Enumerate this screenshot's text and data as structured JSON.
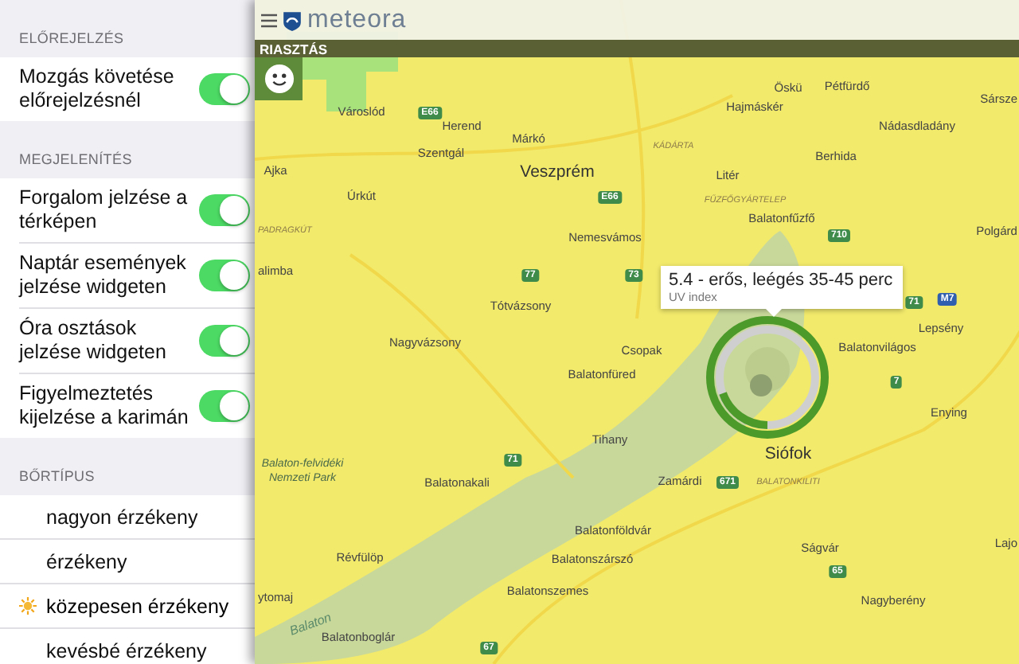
{
  "sidebar": {
    "sections": [
      {
        "title": "ELŐREJELZÉS",
        "kind": "toggles",
        "items": [
          {
            "label": "Mozgás követése előrejelzésnél",
            "on": true
          }
        ]
      },
      {
        "title": "MEGJELENÍTÉS",
        "kind": "toggles",
        "items": [
          {
            "label": "Forgalom jelzése a térképen",
            "on": true
          },
          {
            "label": "Naptár események jelzése widgeten",
            "on": true
          },
          {
            "label": "Óra osztások jelzése widgeten",
            "on": true
          },
          {
            "label": "Figyelmeztetés kijelzése a karimán",
            "on": true
          }
        ]
      },
      {
        "title": "BŐRTÍPUS",
        "kind": "choices",
        "items": [
          {
            "label": "nagyon érzékeny",
            "selected": false
          },
          {
            "label": "érzékeny",
            "selected": false
          },
          {
            "label": "közepesen érzékeny",
            "selected": true
          },
          {
            "label": "kevésbé érzékeny",
            "selected": false
          }
        ]
      }
    ]
  },
  "app_bar": {
    "brand": "meteora"
  },
  "alert_bar": {
    "title": "RIASZTÁS"
  },
  "map": {
    "labels": [
      {
        "text": "Városlód",
        "kind": "place"
      },
      {
        "text": "E66",
        "kind": "road"
      },
      {
        "text": "Herend",
        "kind": "place"
      },
      {
        "text": "Márkó",
        "kind": "place"
      },
      {
        "text": "Szentgál",
        "kind": "place"
      },
      {
        "text": "Ajka",
        "kind": "place"
      },
      {
        "text": "Veszprém",
        "kind": "city"
      },
      {
        "text": "KÁDÁRTA",
        "kind": "area"
      },
      {
        "text": "Öskü",
        "kind": "place"
      },
      {
        "text": "Pétfürdő",
        "kind": "place"
      },
      {
        "text": "Hajmáskér",
        "kind": "place"
      },
      {
        "text": "Nádasdladány",
        "kind": "place"
      },
      {
        "text": "Sársze",
        "kind": "place"
      },
      {
        "text": "Berhida",
        "kind": "place"
      },
      {
        "text": "Litér",
        "kind": "place"
      },
      {
        "text": "Úrkút",
        "kind": "place"
      },
      {
        "text": "E66",
        "kind": "road"
      },
      {
        "text": "FŰZFŐGYÁRTELEP",
        "kind": "area"
      },
      {
        "text": "Balatonfűzfő",
        "kind": "place"
      },
      {
        "text": "PADRAGKÚT",
        "kind": "area"
      },
      {
        "text": "Nemesvámos",
        "kind": "place"
      },
      {
        "text": "710",
        "kind": "road"
      },
      {
        "text": "Polgárd",
        "kind": "place"
      },
      {
        "text": "alimba",
        "kind": "place"
      },
      {
        "text": "77",
        "kind": "road"
      },
      {
        "text": "73",
        "kind": "road"
      },
      {
        "text": "71",
        "kind": "road"
      },
      {
        "text": "Tótvázsony",
        "kind": "place"
      },
      {
        "text": "M7",
        "kind": "highway"
      },
      {
        "text": "Lepsény",
        "kind": "place"
      },
      {
        "text": "Nagyvázsony",
        "kind": "place"
      },
      {
        "text": "Csopak",
        "kind": "place"
      },
      {
        "text": "Balatonfüred",
        "kind": "place"
      },
      {
        "text": "Balatonvilágos",
        "kind": "place"
      },
      {
        "text": "7",
        "kind": "road"
      },
      {
        "text": "Enying",
        "kind": "place"
      },
      {
        "text": "Tihany",
        "kind": "place"
      },
      {
        "text": "Siófok",
        "kind": "city"
      },
      {
        "text": "Balaton-felvidéki Nemzeti Park",
        "kind": "park"
      },
      {
        "text": "71",
        "kind": "road"
      },
      {
        "text": "Balatonakali",
        "kind": "place"
      },
      {
        "text": "Zamárdi",
        "kind": "place"
      },
      {
        "text": "671",
        "kind": "road"
      },
      {
        "text": "BALATONKILITI",
        "kind": "area"
      },
      {
        "text": "Balatonföldvár",
        "kind": "place"
      },
      {
        "text": "Révfülöp",
        "kind": "place"
      },
      {
        "text": "Balatonszárszó",
        "kind": "place"
      },
      {
        "text": "Ságvár",
        "kind": "place"
      },
      {
        "text": "65",
        "kind": "road"
      },
      {
        "text": "Lajo",
        "kind": "place"
      },
      {
        "text": "ytomaj",
        "kind": "place"
      },
      {
        "text": "Balatonszemes",
        "kind": "place"
      },
      {
        "text": "Nagyberény",
        "kind": "place"
      },
      {
        "text": "Balaton",
        "kind": "water"
      },
      {
        "text": "Balatonboglár",
        "kind": "place"
      },
      {
        "text": "67",
        "kind": "road"
      }
    ]
  },
  "tooltip": {
    "value": "5.4 - erős, leégés 35-45 perc",
    "caption": "UV index"
  }
}
